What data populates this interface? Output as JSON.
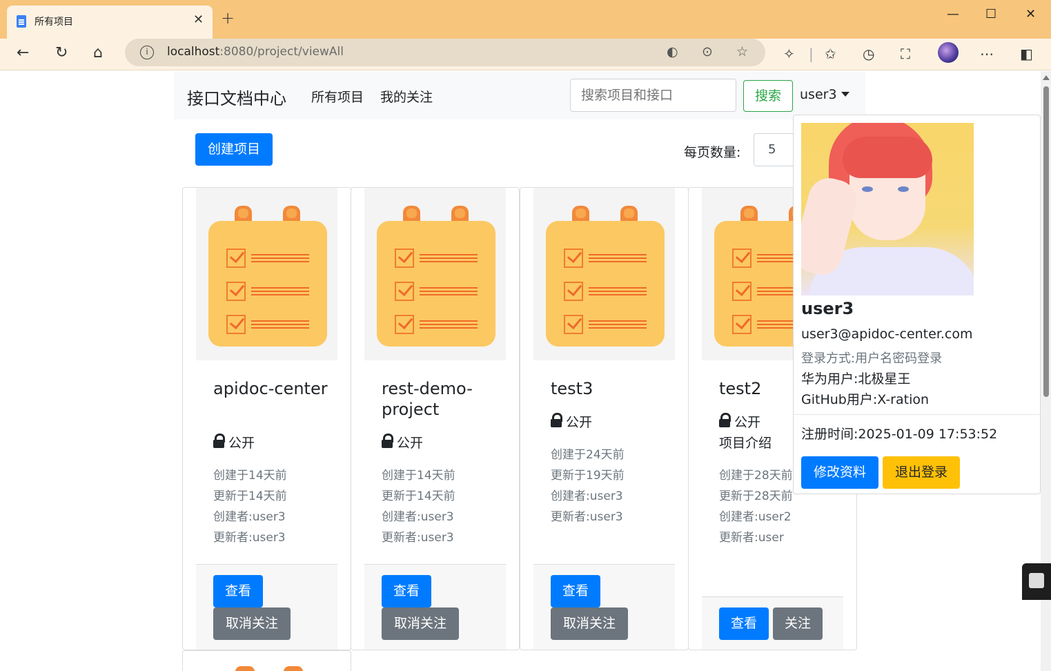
{
  "browser": {
    "tab_title": "所有项目",
    "url_host": "localhost",
    "url_rest": ":8080/project/viewAll"
  },
  "navbar": {
    "brand": "接口文档中心",
    "links": [
      "所有项目",
      "我的关注"
    ],
    "search_placeholder": "搜索项目和接口",
    "search_button": "搜索",
    "user": "user3"
  },
  "toolbar": {
    "create_button": "创建项目",
    "per_page_label": "每页数量:",
    "per_page_value": "5"
  },
  "projects": [
    {
      "title": "apidoc-center",
      "visibility": "公开",
      "description": "",
      "created": "创建于14天前",
      "updated": "更新于14天前",
      "creator": "创建者:user3",
      "updater": "更新者:user3",
      "view_button": "查看",
      "follow_button": "取消关注"
    },
    {
      "title": "rest-demo-project",
      "visibility": "公开",
      "description": "",
      "created": "创建于14天前",
      "updated": "更新于14天前",
      "creator": "创建者:user3",
      "updater": "更新者:user3",
      "view_button": "查看",
      "follow_button": "取消关注"
    },
    {
      "title": "test3",
      "visibility": "公开",
      "description": "",
      "created": "创建于24天前",
      "updated": "更新于19天前",
      "creator": "创建者:user3",
      "updater": "更新者:user3",
      "view_button": "查看",
      "follow_button": "取消关注"
    },
    {
      "title": "test2",
      "visibility": "公开",
      "description": "项目介绍",
      "created": "创建于28天前",
      "updated": "更新于28天前",
      "creator": "创建者:user2",
      "updater": "更新者:user",
      "view_button": "查看",
      "follow_button": "关注"
    }
  ],
  "user_menu": {
    "name": "user3",
    "email": "user3@apidoc-center.com",
    "login_method": "登录方式:用户名密码登录",
    "huawei_user": "华为用户:北极星王",
    "github_user": "GitHub用户:X-ration",
    "registered": "注册时间:2025-01-09 17:53:52",
    "edit_button": "修改资料",
    "logout_button": "退出登录"
  },
  "colors": {
    "primary": "#007bff",
    "secondary": "#6c757d",
    "success": "#28a745",
    "warning": "#ffc107",
    "browser_frame": "#f7c57c"
  }
}
